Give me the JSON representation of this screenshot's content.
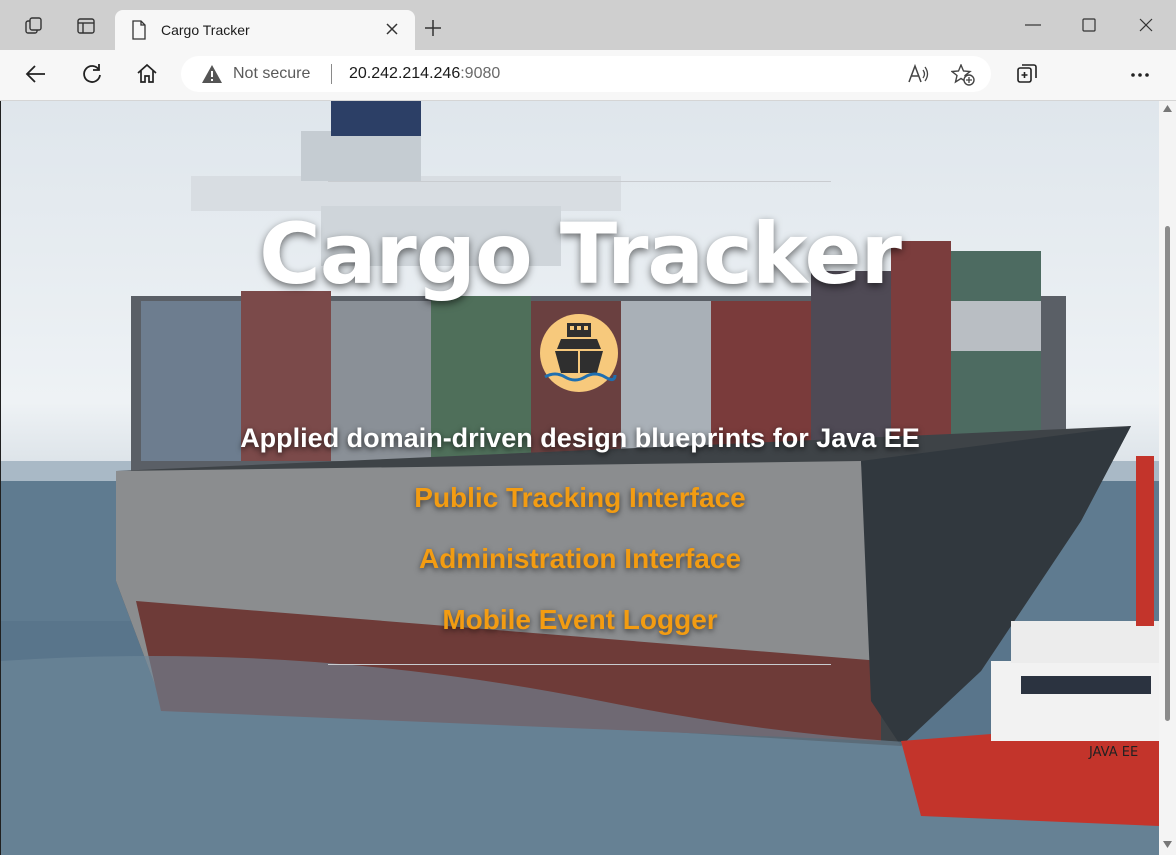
{
  "browser": {
    "tab_title": "Cargo Tracker",
    "address": {
      "security_label": "Not secure",
      "host": "20.242.214.246",
      "port": ":9080"
    }
  },
  "page": {
    "title": "Cargo Tracker",
    "subtitle": "Applied domain-driven design blueprints for Java EE",
    "links": [
      {
        "label": "Public Tracking Interface"
      },
      {
        "label": "Administration Interface"
      },
      {
        "label": "Mobile Event Logger"
      }
    ],
    "tug_label": "JAVA EE",
    "link_color": "#f39c12",
    "logo_color": "#f7c97c"
  }
}
